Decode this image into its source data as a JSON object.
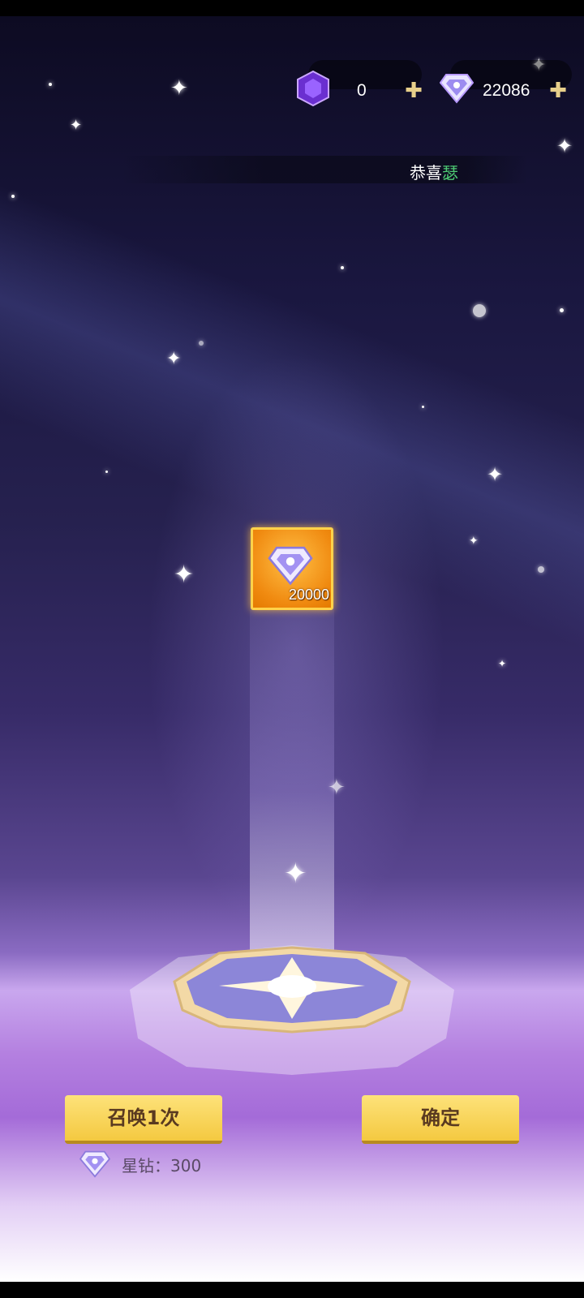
{
  "resources": {
    "purple_gem": {
      "icon": "purple-gem-icon",
      "value": "0"
    },
    "star_diamond": {
      "icon": "diamond-icon",
      "value": "22086"
    }
  },
  "banner": {
    "prefix": "恭喜",
    "name": "瑟"
  },
  "reward": {
    "icon": "diamond-icon",
    "count": "20000"
  },
  "buttons": {
    "summon": "召唤1次",
    "confirm": "确定"
  },
  "cost": {
    "icon": "diamond-icon",
    "label": "星钻：300"
  },
  "colors": {
    "button": "#f4c940",
    "button_text": "#5a3a20",
    "banner_name": "#4ecb74",
    "reward_bg": "#f08a10"
  }
}
